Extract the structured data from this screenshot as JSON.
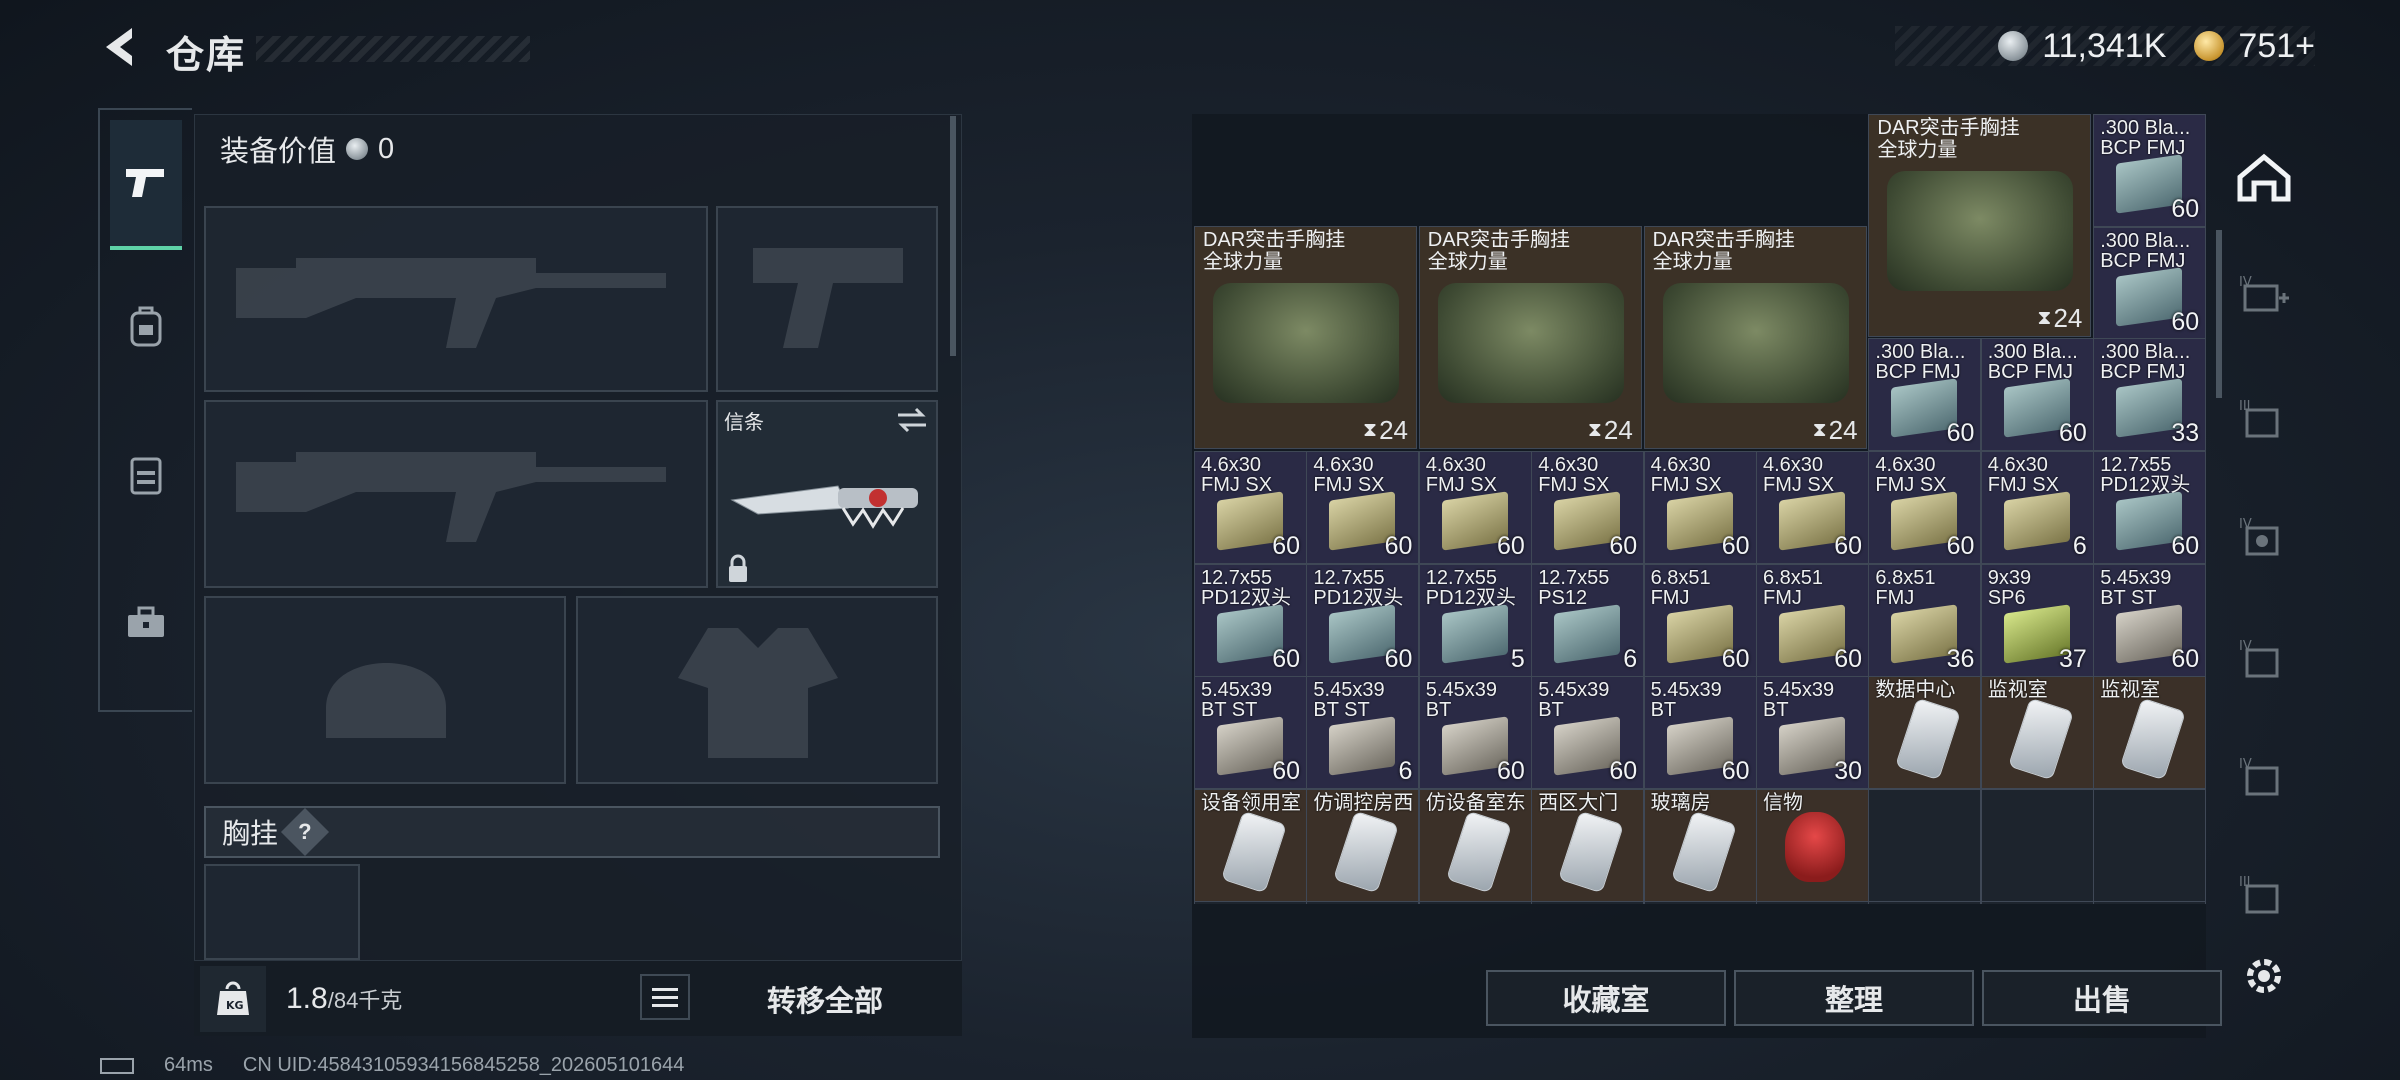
{
  "header": {
    "title": "仓库"
  },
  "currency": {
    "silver": "11,341K",
    "gold": "751+"
  },
  "equipment": {
    "value_label": "装备价值",
    "value": "0",
    "melee_label": "信条",
    "chest_label": "胸挂",
    "chest_help": "?"
  },
  "weight": {
    "current": "1.8",
    "max": "/84千克"
  },
  "actions": {
    "transfer_all": "转移全部",
    "collection": "收藏室",
    "organize": "整理",
    "sell": "出售"
  },
  "status": {
    "ping": "64ms",
    "uid": "CN UID:45843105934156845258_202605101644"
  },
  "stash": {
    "top_row": [
      {
        "count": "24"
      },
      {
        "count": "24"
      },
      {
        "count": "24"
      }
    ],
    "big_items": [
      {
        "name": "DAR突击手胸挂",
        "sub": "全球力量",
        "count": "24"
      },
      {
        "name": "DAR突击手胸挂",
        "sub": "全球力量",
        "count": "24"
      },
      {
        "name": "DAR突击手胸挂",
        "sub": "全球力量",
        "count": "24"
      },
      {
        "name": "DAR突击手胸挂",
        "sub": "全球力量",
        "count": "24"
      }
    ],
    "ammo_300_col": [
      {
        "name": ".300 Bla...",
        "sub": "BCP FMJ",
        "count": "60"
      },
      {
        "name": ".300 Bla...",
        "sub": "BCP FMJ",
        "count": "60"
      }
    ],
    "ammo_300_row": [
      {
        "name": ".300 Bla...",
        "sub": "BCP FMJ",
        "count": "60"
      },
      {
        "name": ".300 Bla...",
        "sub": "BCP FMJ",
        "count": "60"
      },
      {
        "name": ".300 Bla...",
        "sub": "BCP FMJ",
        "count": "33"
      }
    ],
    "row3": [
      {
        "name": "4.6x30",
        "sub": "FMJ SX",
        "count": "60",
        "box": "y"
      },
      {
        "name": "4.6x30",
        "sub": "FMJ SX",
        "count": "60",
        "box": "y"
      },
      {
        "name": "4.6x30",
        "sub": "FMJ SX",
        "count": "60",
        "box": "y"
      },
      {
        "name": "4.6x30",
        "sub": "FMJ SX",
        "count": "60",
        "box": "y"
      },
      {
        "name": "4.6x30",
        "sub": "FMJ SX",
        "count": "60",
        "box": "y"
      },
      {
        "name": "4.6x30",
        "sub": "FMJ SX",
        "count": "60",
        "box": "y"
      },
      {
        "name": "4.6x30",
        "sub": "FMJ SX",
        "count": "60",
        "box": "y"
      },
      {
        "name": "4.6x30",
        "sub": "FMJ SX",
        "count": "6",
        "box": "y"
      },
      {
        "name": "12.7x55",
        "sub": "PD12双头",
        "count": "60",
        "box": "b"
      }
    ],
    "row4": [
      {
        "name": "12.7x55",
        "sub": "PD12双头",
        "count": "60",
        "box": "b"
      },
      {
        "name": "12.7x55",
        "sub": "PD12双头",
        "count": "60",
        "box": "b"
      },
      {
        "name": "12.7x55",
        "sub": "PD12双头",
        "count": "5",
        "box": "b"
      },
      {
        "name": "12.7x55",
        "sub": "PS12",
        "count": "6",
        "box": "b"
      },
      {
        "name": "6.8x51",
        "sub": "FMJ",
        "count": "60",
        "box": "y"
      },
      {
        "name": "6.8x51",
        "sub": "FMJ",
        "count": "60",
        "box": "y"
      },
      {
        "name": "6.8x51",
        "sub": "FMJ",
        "count": "36",
        "box": "y"
      },
      {
        "name": "9x39",
        "sub": "SP6",
        "count": "37",
        "box": "g"
      },
      {
        "name": "5.45x39",
        "sub": "BT ST",
        "count": "60",
        "box": "w"
      }
    ],
    "row5": [
      {
        "name": "5.45x39",
        "sub": "BT ST",
        "count": "60",
        "box": "w"
      },
      {
        "name": "5.45x39",
        "sub": "BT ST",
        "count": "6",
        "box": "w"
      },
      {
        "name": "5.45x39",
        "sub": "BT",
        "count": "60",
        "box": "w"
      },
      {
        "name": "5.45x39",
        "sub": "BT",
        "count": "60",
        "box": "w"
      },
      {
        "name": "5.45x39",
        "sub": "BT",
        "count": "60",
        "box": "w"
      },
      {
        "name": "5.45x39",
        "sub": "BT",
        "count": "30",
        "box": "w"
      },
      {
        "name": "数据中心",
        "sub": "",
        "count": "",
        "box": "key"
      },
      {
        "name": "监视室",
        "sub": "",
        "count": "",
        "box": "key"
      },
      {
        "name": "监视室",
        "sub": "",
        "count": "",
        "box": "key"
      }
    ],
    "row6": [
      {
        "name": "设备领用室",
        "box": "key"
      },
      {
        "name": "仿调控房西",
        "box": "key"
      },
      {
        "name": "仿设备室东",
        "box": "key"
      },
      {
        "name": "西区大门",
        "box": "key"
      },
      {
        "name": "玻璃房",
        "box": "key"
      },
      {
        "name": "信物",
        "box": "skull"
      }
    ]
  }
}
